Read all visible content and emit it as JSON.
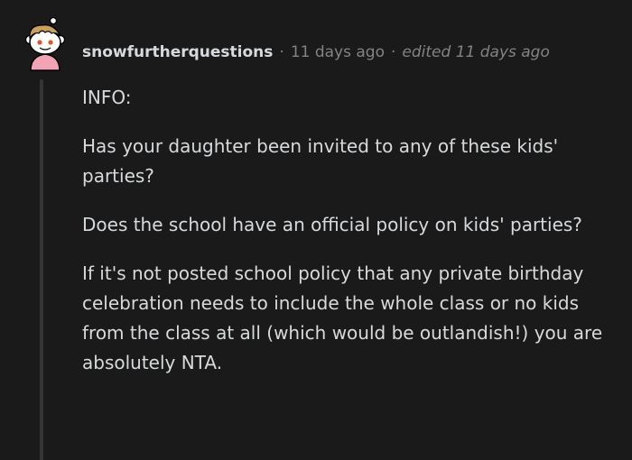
{
  "comment": {
    "username": "snowfurtherquestions",
    "separator": "·",
    "timestamp": "11 days ago",
    "edited_prefix": "edited",
    "edited_time": "11 days ago",
    "paragraphs": {
      "info": "INFO:",
      "q1": "Has your daughter been invited to any of these kids' parties?",
      "q2": "Does the school have an official policy on kids' parties?",
      "q3": "If it's not posted school policy that any private birthday celebration needs to include the whole class or no kids from the class at all (which would be outlandish!) you are absolutely NTA."
    }
  },
  "colors": {
    "background": "#1a1a1b",
    "text": "#d7dadc",
    "meta": "#818384",
    "thread_line": "#343536"
  }
}
